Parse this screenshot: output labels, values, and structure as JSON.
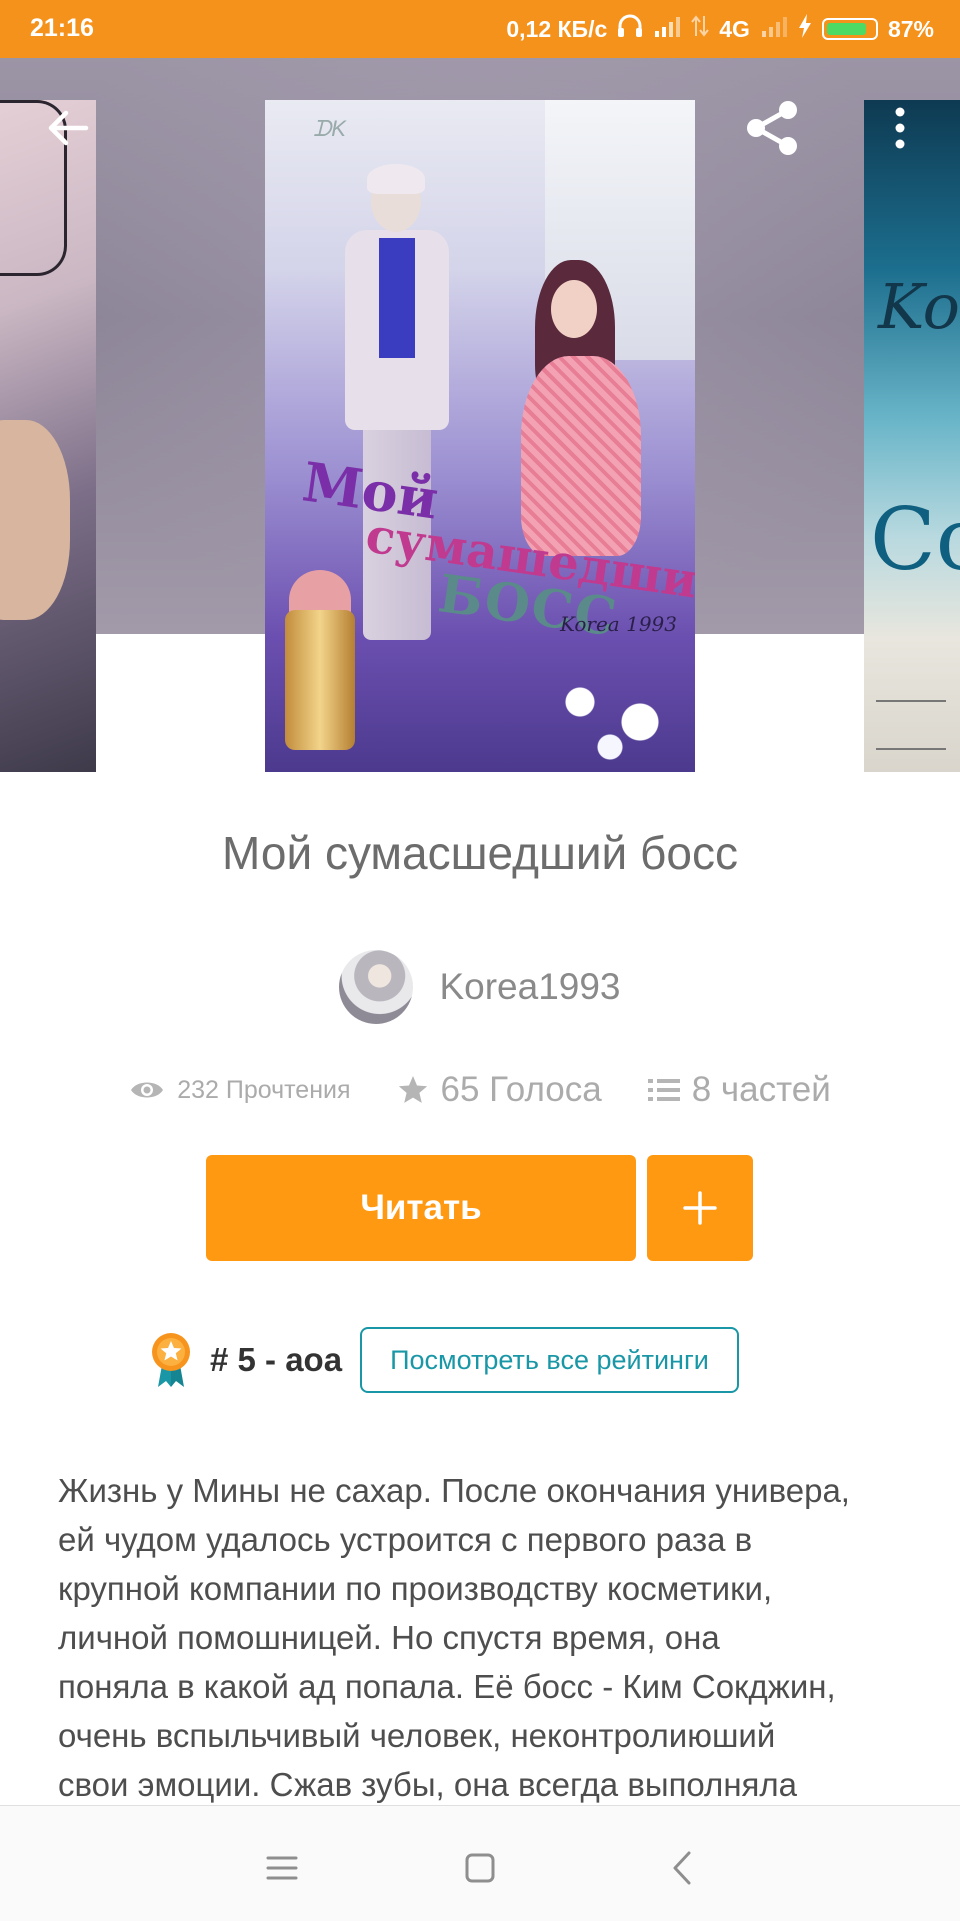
{
  "status_bar": {
    "time": "21:16",
    "speed": "0,12 КБ/с",
    "network": "4G",
    "battery": "87%",
    "battery_level": 0.87,
    "accent_color": "#f5921c"
  },
  "toolbar": {
    "icons": [
      "arrow-left-icon",
      "share-icon",
      "more-vertical-icon"
    ]
  },
  "covers": {
    "main": {
      "title_line1": "Мой",
      "title_line2": "сумашедший",
      "title_line3": "БОСС",
      "signature": "Korea 1993",
      "mark": "ᗪK"
    },
    "right": {
      "text1": "Kor",
      "text2": "Co"
    }
  },
  "story": {
    "title": "Мой сумасшедший босс",
    "author": "Korea1993",
    "reads": "232 Прочтения",
    "votes": "65 Голоса",
    "parts": "8 частей"
  },
  "actions": {
    "read_label": "Читать",
    "add_icon": "plus-icon",
    "button_color": "#ff9912"
  },
  "ranking": {
    "text": "# 5 - аоа",
    "link_label": "Посмотреть все рейтинги",
    "link_color": "#1a97a6"
  },
  "description": "Жизнь у Мины не сахар. После окончания универа,\nей чудом удалось устроится с первого раза в\nкрупной компании по производству косметики,\nличной помошницей. Но спустя время, она\nпоняла в какой ад попала. Её босс - Ким Сокджин,\nочень вспыльчивый человек, неконтролиюший\nсвои эмоции. Сжав зубы, она всегда выполняла",
  "nav_bar": {
    "icons": [
      "menu-icon",
      "home-square-icon",
      "back-chevron-icon"
    ]
  }
}
